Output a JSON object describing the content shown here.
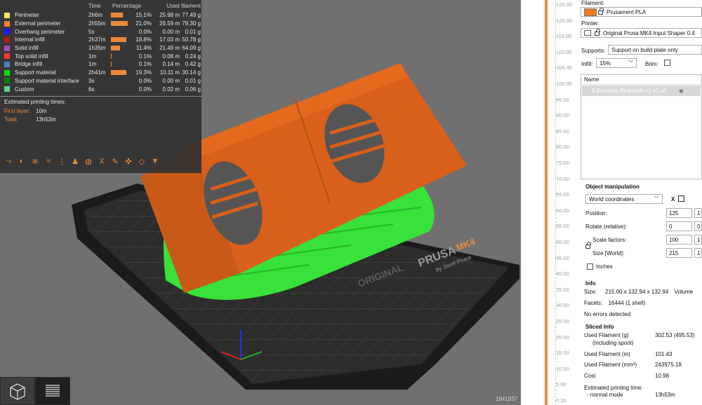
{
  "legend": {
    "headers": {
      "time": "Time",
      "percentage": "Percentage",
      "used_filament": "Used filament"
    },
    "rows": [
      {
        "name": "Perimeter",
        "color": "#ffe65c",
        "time": "2h6m",
        "pct": "15.1%",
        "len": "25.98 m",
        "weight": "77.49 g",
        "bar": 0.72
      },
      {
        "name": "External perimeter",
        "color": "#ff8133",
        "time": "2h55m",
        "pct": "21.0%",
        "len": "26.59 m",
        "weight": "79.30 g",
        "bar": 1.0
      },
      {
        "name": "Overhang perimeter",
        "color": "#1a1aff",
        "time": "5s",
        "pct": "0.0%",
        "len": "0.00 m",
        "weight": "0.01 g",
        "bar": 0.0
      },
      {
        "name": "Internal infill",
        "color": "#b01a1a",
        "time": "2h37m",
        "pct": "18.8%",
        "len": "17.03 m",
        "weight": "50.78 g",
        "bar": 0.9
      },
      {
        "name": "Solid infill",
        "color": "#a64dbd",
        "time": "1h35m",
        "pct": "11.4%",
        "len": "21.49 m",
        "weight": "64.09 g",
        "bar": 0.54
      },
      {
        "name": "Top solid infill",
        "color": "#ff3333",
        "time": "1m",
        "pct": "0.1%",
        "len": "0.08 m",
        "weight": "0.24 g",
        "bar": 0.02
      },
      {
        "name": "Bridge infill",
        "color": "#4d80ba",
        "time": "1m",
        "pct": "0.1%",
        "len": "0.14 m",
        "weight": "0.42 g",
        "bar": 0.02
      },
      {
        "name": "Support material",
        "color": "#00e600",
        "time": "2h41m",
        "pct": "19.3%",
        "len": "10.11 m",
        "weight": "30.14 g",
        "bar": 0.92
      },
      {
        "name": "Support material interface",
        "color": "#008000",
        "time": "3s",
        "pct": "0.0%",
        "len": "0.00 m",
        "weight": "0.01 g",
        "bar": 0.0
      },
      {
        "name": "Custom",
        "color": "#5ed194",
        "time": "6s",
        "pct": "0.0%",
        "len": "0.02 m",
        "weight": "0.06 g",
        "bar": 0.0
      }
    ],
    "est_title": "Estimated printing times:",
    "first_layer_label": "First layer:",
    "first_layer_value": "10m",
    "total_label": "Total:",
    "total_value": "13h53m",
    "icons": [
      "travel-icon",
      "wipe-icon",
      "retractions-icon",
      "deretractions-icon",
      "seams-icon",
      "tool-changes-icon",
      "color-changes-icon",
      "pause-prints-icon",
      "custom-gcodes-icon",
      "center-of-gravity-icon",
      "shells-icon",
      "tool-marker-icon"
    ]
  },
  "bed": {
    "brand_line1": "ORIGINAL",
    "brand_line2": "PRUSA",
    "brand_line3": "MK4",
    "brand_sub": "by Josef Prusa"
  },
  "build_id": "1841937",
  "ruler": {
    "ticks": [
      "125.00",
      "120.00",
      "115.00",
      "110.00",
      "105.00",
      "100.00",
      "95.00",
      "90.00",
      "85.00",
      "80.00",
      "75.00",
      "70.00",
      "65.00",
      "60.00",
      "55.00",
      "50.00",
      "45.00",
      "40.00",
      "35.00",
      "30.00",
      "25.00",
      "20.00",
      "15.00",
      "10.00",
      "5.00",
      "0.20"
    ]
  },
  "sidebar": {
    "filament_label": "Filament:",
    "filament_value": "Prusament PLA",
    "filament_color": "#f07a1a",
    "printer_label": "Printer:",
    "printer_value": "Original Prusa MK4 Input Shaper 0.4",
    "supports_label": "Supports:",
    "supports_value": "Support on build plate only",
    "infill_label": "Infill:",
    "infill_value": "15%",
    "brim_label": "Brim:",
    "list_header": "Name",
    "object_name": "5-Enceinte Bluetooth v1 v1.stl",
    "objman_title": "Object manipulation",
    "coords_value": "World coordinates",
    "axis_x": "X",
    "position_label": "Position:",
    "position_x": "125",
    "position_y": "1",
    "rotate_label": "Rotate (relative):",
    "rotate_x": "0",
    "rotate_y": "0",
    "scale_label": "Scale factors:",
    "scale_x": "100",
    "scale_y": "1",
    "size_label": "Size [World]:",
    "size_x": "215",
    "size_y": "1",
    "inches_label": "Inches",
    "info_title": "Info",
    "size_info_label": "Size:",
    "size_info_value": "215.00 x 132.94 x 132.94",
    "volume_label": "Volume",
    "facets_label": "Facets:",
    "facets_value": "16444 (1 shell)",
    "errors": "No errors detected",
    "sliced_title": "Sliced Info",
    "used_g_label": "Used Filament (g)",
    "used_g_sub": "(including spool)",
    "used_g_value": "302.53 (495.53)",
    "used_m_label": "Used Filament (m)",
    "used_m_value": "101.43",
    "used_mm3_label": "Used Filament (mm³)",
    "used_mm3_value": "243975.18",
    "cost_label": "Cost",
    "cost_value": "10.98",
    "est_label": "Estimated printing time:",
    "est_mode": "- normal mode",
    "est_value": "13h53m"
  }
}
